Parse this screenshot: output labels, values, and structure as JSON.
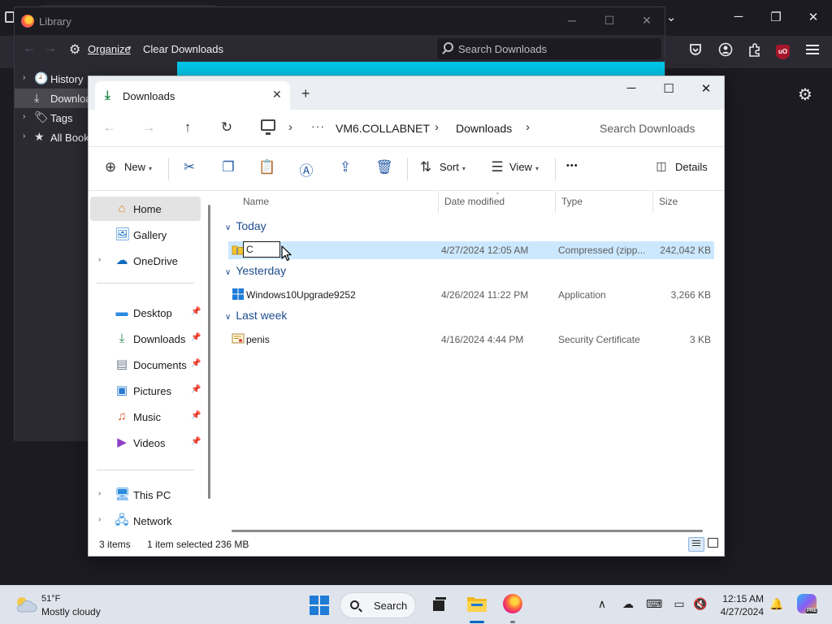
{
  "firefox": {
    "window_controls": {
      "minimize": "─",
      "restore": "❐",
      "close": "✕",
      "chevron": "⌄"
    },
    "ublock_label": "uO"
  },
  "library": {
    "title": "Library",
    "organize": "Organize",
    "clear_downloads": "Clear Downloads",
    "search_placeholder": "Search Downloads",
    "tree": [
      {
        "label": "History"
      },
      {
        "label": "Downloads"
      },
      {
        "label": "Tags"
      },
      {
        "label": "All Bookmarks"
      }
    ]
  },
  "explorer": {
    "tab_title": "Downloads",
    "address": {
      "segments": [
        "VM6.COLLABNET",
        "Downloads"
      ]
    },
    "search_placeholder": "Search Downloads",
    "toolbar": {
      "new_label": "New",
      "sort_label": "Sort",
      "view_label": "View",
      "details_label": "Details",
      "more_label": "•••"
    },
    "nav": {
      "home": "Home",
      "gallery": "Gallery",
      "onedrive": "OneDrive",
      "desktop": "Desktop",
      "downloads": "Downloads",
      "documents": "Documents",
      "pictures": "Pictures",
      "music": "Music",
      "videos": "Videos",
      "thispc": "This PC",
      "network": "Network"
    },
    "columns": {
      "name": "Name",
      "date": "Date modified",
      "type": "Type",
      "size": "Size"
    },
    "groups": {
      "today": {
        "label": "Today",
        "file": {
          "name_edit": "C",
          "date": "4/27/2024 12:05 AM",
          "type": "Compressed (zipp...",
          "size": "242,042 KB"
        }
      },
      "yesterday": {
        "label": "Yesterday",
        "file": {
          "name": "Windows10Upgrade9252",
          "date": "4/26/2024 11:22 PM",
          "type": "Application",
          "size": "3,266 KB"
        }
      },
      "lastweek": {
        "label": "Last week",
        "file": {
          "name": "penis",
          "date": "4/16/2024 4:44 PM",
          "type": "Security Certificate",
          "size": "3 KB"
        }
      }
    },
    "status": {
      "count": "3 items",
      "selection": "1 item selected  236 MB"
    }
  },
  "taskbar": {
    "temp": "51°F",
    "weather": "Mostly cloudy",
    "search_label": "Search",
    "time": "12:15 AM",
    "date": "4/27/2024",
    "copilot_badge": "PRE"
  }
}
